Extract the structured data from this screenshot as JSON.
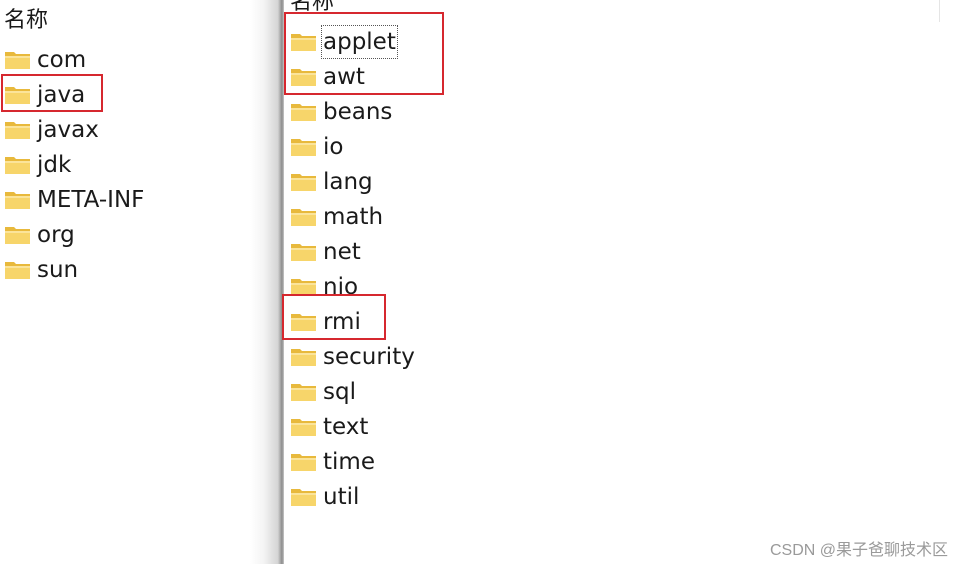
{
  "left_pane": {
    "header": "名称",
    "folders": [
      "com",
      "java",
      "javax",
      "jdk",
      "META-INF",
      "org",
      "sun"
    ]
  },
  "right_pane": {
    "header": "名称",
    "folders": [
      "applet",
      "awt",
      "beans",
      "io",
      "lang",
      "math",
      "net",
      "nio",
      "rmi",
      "security",
      "sql",
      "text",
      "time",
      "util"
    ]
  },
  "colors": {
    "highlight_border": "#d6282f",
    "folder_fill": "#f7d56a",
    "folder_tab": "#e8b93c",
    "text": "#1a1a1a"
  },
  "icons": {
    "folder": "folder-icon"
  },
  "watermark": "CSDN @果子爸聊技术区"
}
